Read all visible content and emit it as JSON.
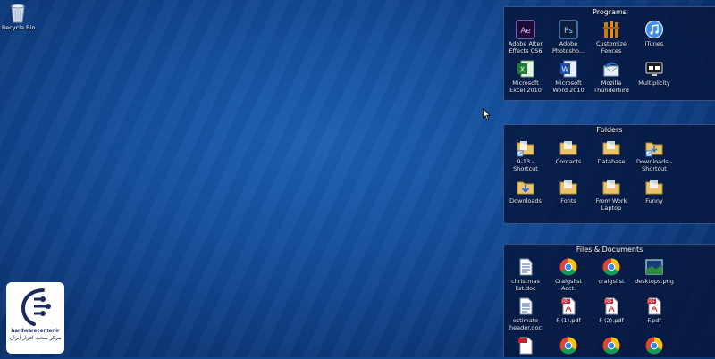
{
  "desktop": {
    "recycle_bin_label": "Recycle Bin"
  },
  "fences": [
    {
      "title": "Programs",
      "items": [
        {
          "label": "Adobe After Effects CS6",
          "icon": "after-effects-icon"
        },
        {
          "label": "Adobe Photosho...",
          "icon": "photoshop-icon"
        },
        {
          "label": "Customize Fences",
          "icon": "fences-icon"
        },
        {
          "label": "iTunes",
          "icon": "itunes-icon"
        },
        {
          "label": "Microsoft Excel 2010",
          "icon": "excel-icon"
        },
        {
          "label": "Microsoft Word 2010",
          "icon": "word-icon"
        },
        {
          "label": "Mozilla Thunderbird",
          "icon": "thunderbird-icon"
        },
        {
          "label": "Multiplicity",
          "icon": "multiplicity-icon"
        }
      ]
    },
    {
      "title": "Folders",
      "items": [
        {
          "label": "9-13 - Shortcut",
          "icon": "folder-shortcut-icon"
        },
        {
          "label": "Contacts",
          "icon": "folder-icon"
        },
        {
          "label": "Database",
          "icon": "folder-icon"
        },
        {
          "label": "Downloads - Shortcut",
          "icon": "folder-shortcut-icon"
        },
        {
          "label": "Downloads",
          "icon": "downloads-folder-icon"
        },
        {
          "label": "Fonts",
          "icon": "folder-icon"
        },
        {
          "label": "From Work Laptop",
          "icon": "folder-icon"
        },
        {
          "label": "Funny",
          "icon": "folder-icon"
        }
      ]
    },
    {
      "title": "Files & Documents",
      "items": [
        {
          "label": "christmas list.doc",
          "icon": "doc-file-icon"
        },
        {
          "label": "Craigslist Acct.",
          "icon": "chrome-icon"
        },
        {
          "label": "craigslist",
          "icon": "chrome-icon"
        },
        {
          "label": "desktops.png",
          "icon": "png-file-icon"
        },
        {
          "label": "estimate header.doc",
          "icon": "doc-file-icon"
        },
        {
          "label": "F (1).pdf",
          "icon": "pdf-file-icon"
        },
        {
          "label": "F (2).pdf",
          "icon": "pdf-file-icon"
        },
        {
          "label": "F.pdf",
          "icon": "pdf-file-icon"
        },
        {
          "label": "",
          "icon": "pdf-file-icon"
        },
        {
          "label": "",
          "icon": "chrome-icon"
        },
        {
          "label": "",
          "icon": "chrome-icon"
        },
        {
          "label": "",
          "icon": "chrome-icon"
        }
      ]
    }
  ],
  "watermark": {
    "site": "hardwarecenter.ir",
    "tagline": "مرکز سخت افزار ایران"
  }
}
